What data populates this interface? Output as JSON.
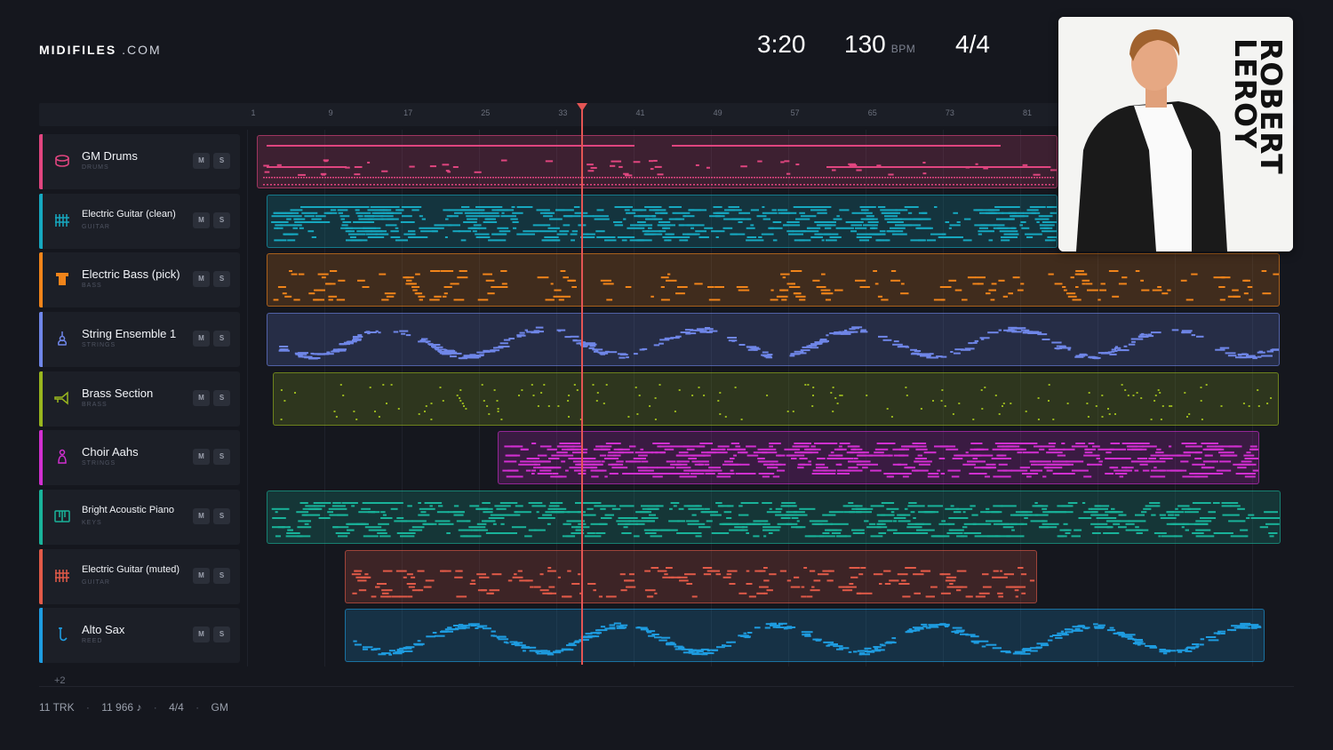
{
  "header": {
    "logo_main": "MIDIFILES",
    "logo_domain": ".COM",
    "time": "3:20",
    "tempo": "130",
    "tempo_unit": "BPM",
    "signature": "4/4"
  },
  "ruler": {
    "ticks": [
      "1",
      "9",
      "17",
      "25",
      "33",
      "41",
      "49",
      "57",
      "65",
      "73",
      "81"
    ]
  },
  "tracks": [
    {
      "name": "GM Drums",
      "category": "DRUMS",
      "color": "#e0457f",
      "icon": "drum-icon",
      "mute": "M",
      "solo": "S"
    },
    {
      "name": "Electric Guitar (clean)",
      "category": "GUITAR",
      "color": "#16a8c0",
      "icon": "guitar-grid-icon",
      "mute": "M",
      "solo": "S"
    },
    {
      "name": "Electric Bass (pick)",
      "category": "BASS",
      "color": "#f0841a",
      "icon": "bass-icon",
      "mute": "M",
      "solo": "S"
    },
    {
      "name": "String Ensemble 1",
      "category": "STRINGS",
      "color": "#6f86e8",
      "icon": "violin-icon",
      "mute": "M",
      "solo": "S"
    },
    {
      "name": "Brass Section",
      "category": "BRASS",
      "color": "#98b51e",
      "icon": "trumpet-icon",
      "mute": "M",
      "solo": "S"
    },
    {
      "name": "Choir Aahs",
      "category": "STRINGS",
      "color": "#d12fd0",
      "icon": "choir-icon",
      "mute": "M",
      "solo": "S"
    },
    {
      "name": "Bright Acoustic Piano",
      "category": "KEYS",
      "color": "#19b39a",
      "icon": "piano-icon",
      "mute": "M",
      "solo": "S"
    },
    {
      "name": "Electric Guitar (muted)",
      "category": "GUITAR",
      "color": "#e15a48",
      "icon": "guitar-grid-icon",
      "mute": "M",
      "solo": "S"
    },
    {
      "name": "Alto Sax",
      "category": "REED",
      "color": "#1e9ce0",
      "icon": "sax-icon",
      "mute": "M",
      "solo": "S"
    }
  ],
  "more_tracks": "+2",
  "footer": {
    "tracks": "11 TRK",
    "notes": "11 966 ♪",
    "signature": "4/4",
    "standard": "GM",
    "sep": "·"
  },
  "album": {
    "artist_line1": "ROBERT",
    "artist_line2": "LEROY"
  }
}
